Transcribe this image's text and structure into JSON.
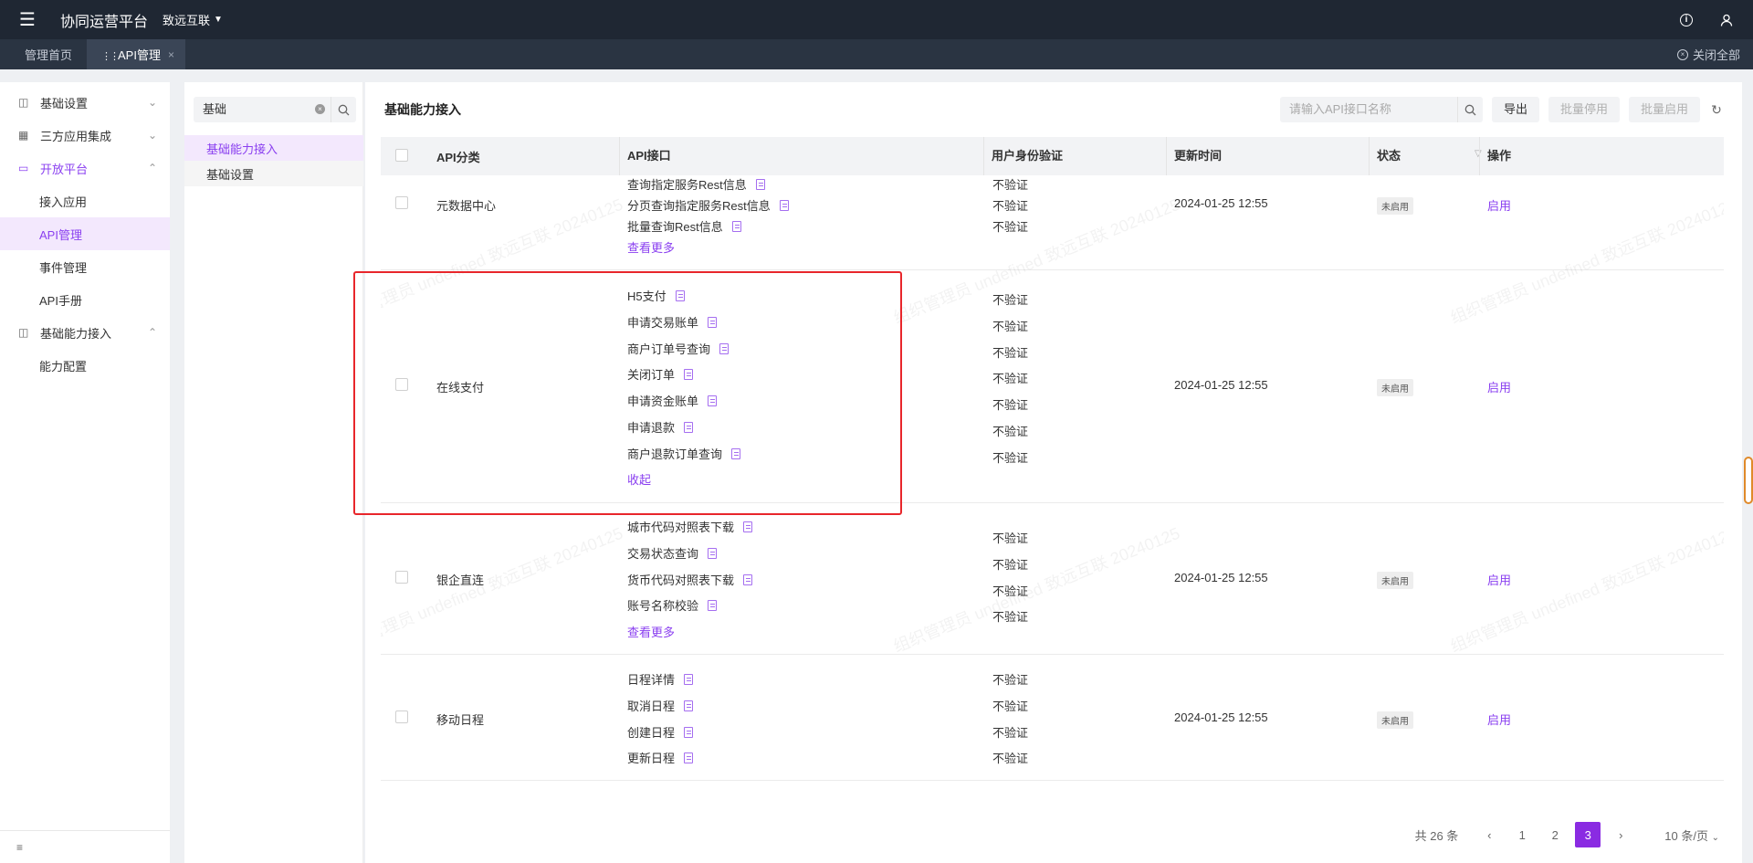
{
  "app": {
    "title": "协同运营平台",
    "org": "致远互联"
  },
  "tabs": {
    "home": "管理首页",
    "current": "API管理",
    "close_all": "关闭全部"
  },
  "sidebar": {
    "groups": [
      {
        "label": "基础设置",
        "icon": "monitor-icon",
        "expanded": false
      },
      {
        "label": "三方应用集成",
        "icon": "apps-icon",
        "expanded": false
      },
      {
        "label": "开放平台",
        "icon": "desktop-icon",
        "expanded": true,
        "children": [
          "接入应用",
          "API管理",
          "事件管理",
          "API手册"
        ]
      },
      {
        "label": "基础能力接入",
        "icon": "grid-icon",
        "expanded": true,
        "children": [
          "能力配置"
        ]
      }
    ],
    "active_item": "API管理"
  },
  "tree": {
    "search_value": "基础",
    "nodes": [
      "基础能力接入",
      "基础设置"
    ]
  },
  "main": {
    "title": "基础能力接入",
    "search_placeholder": "请输入API接口名称",
    "export_label": "导出",
    "batch_disable_label": "批量停用",
    "batch_enable_label": "批量启用"
  },
  "table": {
    "headers": {
      "category": "API分类",
      "api": "API接口",
      "auth": "用户身份验证",
      "updated": "更新时间",
      "status": "状态",
      "action": "操作"
    },
    "rows": [
      {
        "category": "元数据中心",
        "apis": [
          "查询指定服务Rest信息",
          "分页查询指定服务Rest信息",
          "批量查询Rest信息"
        ],
        "auth": [
          "不验证",
          "不验证",
          "不验证"
        ],
        "more": "查看更多",
        "updated": "2024-01-25 12:55",
        "status": "未启用",
        "action": "启用"
      },
      {
        "category": "在线支付",
        "apis": [
          "H5支付",
          "申请交易账单",
          "商户订单号查询",
          "关闭订单",
          "申请资金账单",
          "申请退款",
          "商户退款订单查询"
        ],
        "auth": [
          "不验证",
          "不验证",
          "不验证",
          "不验证",
          "不验证",
          "不验证",
          "不验证"
        ],
        "more": "收起",
        "updated": "2024-01-25 12:55",
        "status": "未启用",
        "action": "启用"
      },
      {
        "category": "银企直连",
        "apis": [
          "城市代码对照表下载",
          "交易状态查询",
          "货币代码对照表下载",
          "账号名称校验"
        ],
        "auth": [
          "不验证",
          "不验证",
          "不验证",
          "不验证"
        ],
        "more": "查看更多",
        "updated": "2024-01-25 12:55",
        "status": "未启用",
        "action": "启用"
      },
      {
        "category": "移动日程",
        "apis": [
          "日程详情",
          "取消日程",
          "创建日程",
          "更新日程"
        ],
        "auth": [
          "不验证",
          "不验证",
          "不验证",
          "不验证"
        ],
        "more": "",
        "updated": "2024-01-25 12:55",
        "status": "未启用",
        "action": "启用"
      }
    ]
  },
  "pagination": {
    "total": "共 26 条",
    "pages": [
      "1",
      "2",
      "3"
    ],
    "current": "3",
    "page_size": "10 条/页"
  },
  "watermark": "组织管理员 undefined 致远互联 20240125",
  "colors": {
    "accent": "#8a3ff0",
    "topbar": "#1f2733",
    "highlight": "#e8262b"
  }
}
